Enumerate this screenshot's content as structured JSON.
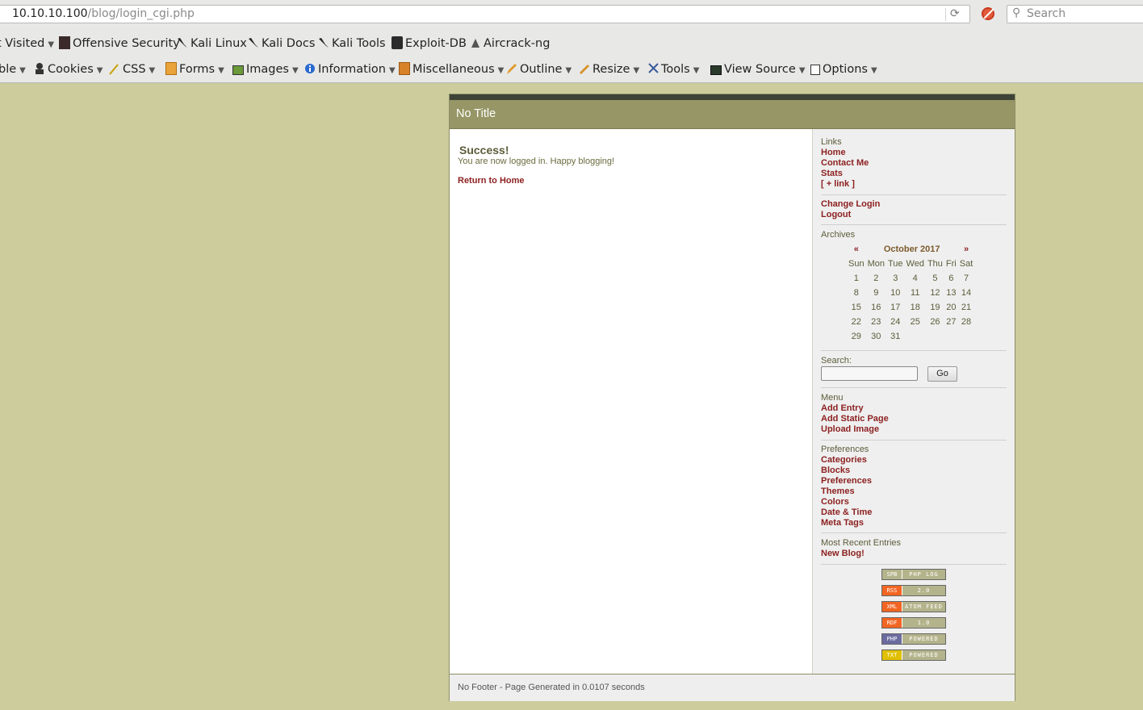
{
  "browser": {
    "url_host": "10.10.10.100",
    "url_path": "/blog/login_cgi.php",
    "search_placeholder": "Search",
    "bookmarks": [
      {
        "label": "t Visited",
        "icon": "dropdown"
      },
      {
        "label": "Offensive Security",
        "icon": "offsec-icon"
      },
      {
        "label": "Kali Linux",
        "icon": "kali-dragon-icon"
      },
      {
        "label": "Kali Docs",
        "icon": "kali-dragon-icon"
      },
      {
        "label": "Kali Tools",
        "icon": "kali-dragon-icon"
      },
      {
        "label": "Exploit-DB",
        "icon": "exploit-db-icon"
      },
      {
        "label": "Aircrack-ng",
        "icon": "aircrack-icon"
      }
    ],
    "dev_toolbar": [
      {
        "label": "ble"
      },
      {
        "label": "Cookies"
      },
      {
        "label": "CSS"
      },
      {
        "label": "Forms"
      },
      {
        "label": "Images"
      },
      {
        "label": "Information"
      },
      {
        "label": "Miscellaneous"
      },
      {
        "label": "Outline"
      },
      {
        "label": "Resize"
      },
      {
        "label": "Tools"
      },
      {
        "label": "View Source"
      },
      {
        "label": "Options"
      }
    ]
  },
  "page": {
    "title": "No Title",
    "success_title": "Success!",
    "success_msg": "You are now logged in. Happy blogging!",
    "return_link": "Return to Home",
    "footer": "No Footer - Page Generated in 0.0107 seconds"
  },
  "sidebar": {
    "links_head": "Links",
    "links": [
      "Home",
      "Contact Me",
      "Stats",
      "[ + link ]"
    ],
    "account_links": [
      "Change Login",
      "Logout"
    ],
    "archives_head": "Archives",
    "calendar": {
      "prev": "«",
      "next": "»",
      "month": "October 2017",
      "days": [
        "Sun",
        "Mon",
        "Tue",
        "Wed",
        "Thu",
        "Fri",
        "Sat"
      ],
      "weeks": [
        [
          "1",
          "2",
          "3",
          "4",
          "5",
          "6",
          "7"
        ],
        [
          "8",
          "9",
          "10",
          "11",
          "12",
          "13",
          "14"
        ],
        [
          "15",
          "16",
          "17",
          "18",
          "19",
          "20",
          "21"
        ],
        [
          "22",
          "23",
          "24",
          "25",
          "26",
          "27",
          "28"
        ],
        [
          "29",
          "30",
          "31",
          "",
          "",
          "",
          ""
        ]
      ]
    },
    "search_label": "Search:",
    "go_label": "Go",
    "menu_head": "Menu",
    "menu_links": [
      "Add Entry",
      "Add Static Page",
      "Upload Image"
    ],
    "prefs_head": "Preferences",
    "prefs_links": [
      "Categories",
      "Blocks",
      "Preferences",
      "Themes",
      "Colors",
      "Date & Time",
      "Meta Tags"
    ],
    "recent_head": "Most Recent Entries",
    "recent_links": [
      "New Blog!"
    ],
    "badges": [
      {
        "left": "SPB",
        "right": "PHP LOG",
        "color": "#b4b48c"
      },
      {
        "left": "RSS",
        "right": "2.0",
        "color": "#f26522"
      },
      {
        "left": "XML",
        "right": "ATOM FEED",
        "color": "#f26522"
      },
      {
        "left": "RDF",
        "right": "1.0",
        "color": "#f26522"
      },
      {
        "left": "PHP",
        "right": "POWERED",
        "color": "#6c6ca0"
      },
      {
        "left": "TXT",
        "right": "POWERED",
        "color": "#e0c000"
      }
    ]
  }
}
